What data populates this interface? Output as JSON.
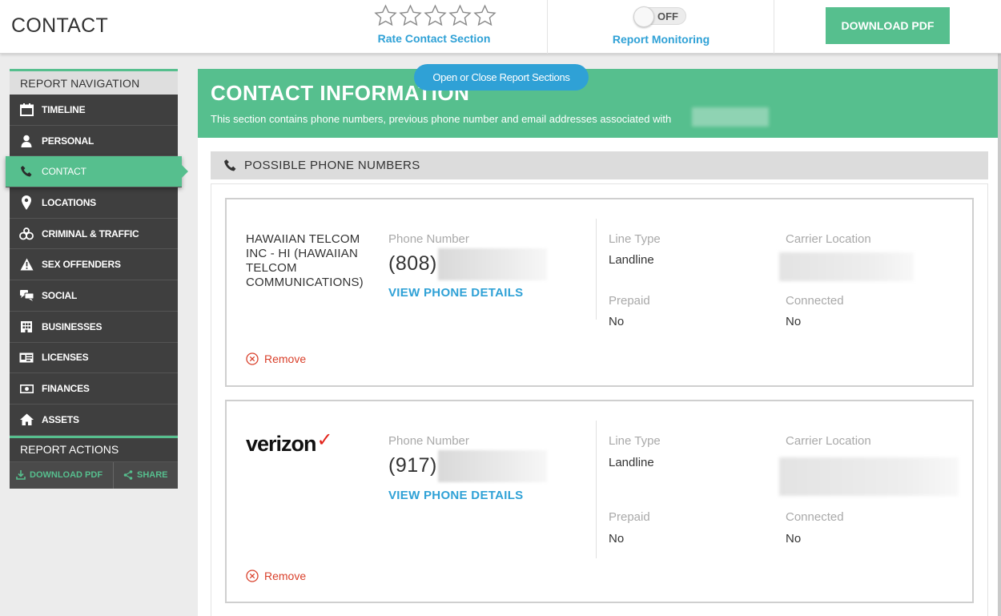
{
  "header": {
    "title": "CONTACT",
    "rate_label": "Rate Contact Section",
    "stars_total": 5,
    "stars_filled": 0,
    "monitor_toggle": "OFF",
    "monitor_label": "Report Monitoring",
    "download_label": "DOWNLOAD PDF"
  },
  "sidebar": {
    "nav_title": "REPORT NAVIGATION",
    "items": [
      {
        "label": "TIMELINE",
        "icon": "calendar-icon"
      },
      {
        "label": "PERSONAL",
        "icon": "person-icon"
      },
      {
        "label": "CONTACT",
        "icon": "phone-icon",
        "active": true
      },
      {
        "label": "LOCATIONS",
        "icon": "map-pin-icon"
      },
      {
        "label": "CRIMINAL & TRAFFIC",
        "icon": "handcuffs-icon"
      },
      {
        "label": "SEX OFFENDERS",
        "icon": "warning-icon"
      },
      {
        "label": "SOCIAL",
        "icon": "chat-icon"
      },
      {
        "label": "BUSINESSES",
        "icon": "building-icon"
      },
      {
        "label": "LICENSES",
        "icon": "id-card-icon"
      },
      {
        "label": "FINANCES",
        "icon": "money-icon"
      },
      {
        "label": "ASSETS",
        "icon": "home-icon"
      }
    ],
    "actions_title": "REPORT ACTIONS",
    "download_label": "DOWNLOAD PDF",
    "share_label": "SHARE"
  },
  "main": {
    "toggle_sections_label": "Open or Close Report Sections",
    "banner_title": "CONTACT INFORMATION",
    "banner_subtitle": "This section contains phone numbers, previous phone number and email addresses associated with",
    "section_title": "POSSIBLE PHONE NUMBERS",
    "labels": {
      "phone_number": "Phone Number",
      "view_details": "VIEW PHONE DETAILS",
      "line_type": "Line Type",
      "carrier_location": "Carrier Location",
      "prepaid": "Prepaid",
      "connected": "Connected",
      "remove": "Remove"
    },
    "phones": [
      {
        "carrier": "HAWAIIAN TELCOM INC - HI (HAWAIIAN TELCOM COMMUNICATIONS)",
        "area_code": "(808)",
        "line_type": "Landline",
        "prepaid": "No",
        "connected": "No"
      },
      {
        "carrier_logo": "verizon",
        "carrier_logo_mark": "✓",
        "area_code": "(917)",
        "line_type": "Landline",
        "prepaid": "No",
        "connected": "No"
      }
    ]
  }
}
